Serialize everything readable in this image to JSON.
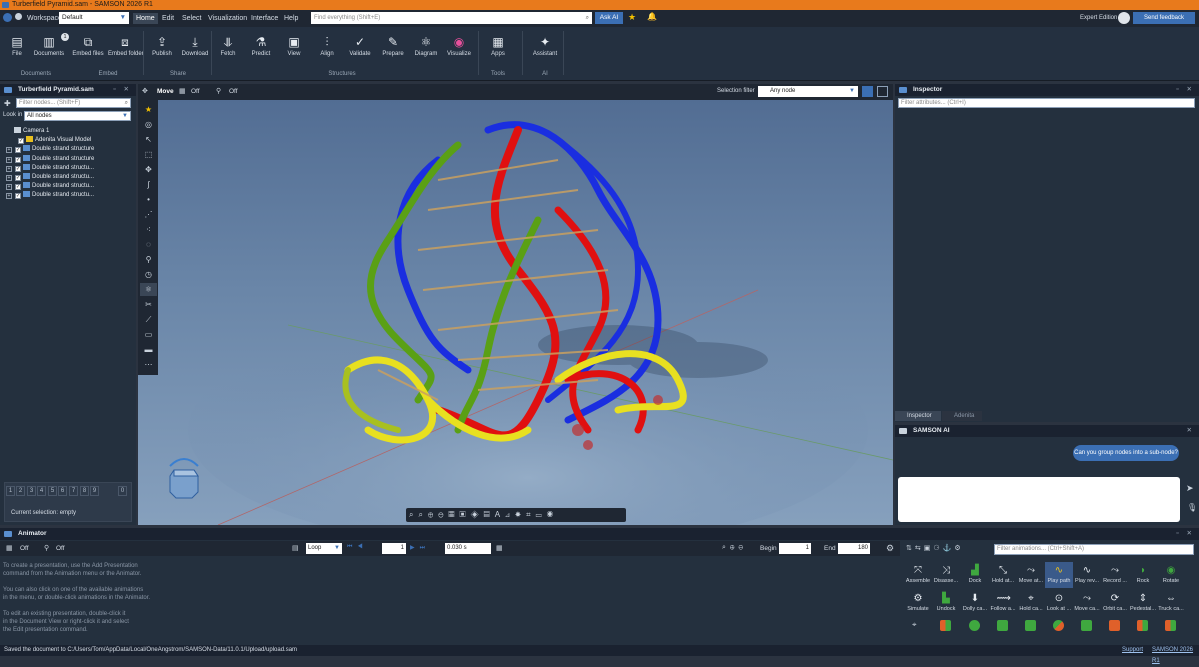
{
  "window": {
    "title": "Turberfield Pyramid.sam - SAMSON 2026 R1"
  },
  "menubar": {
    "workspace_label": "Workspace",
    "workspace_value": "Default",
    "menus": [
      "Home",
      "Edit",
      "Select",
      "Visualization",
      "Interface",
      "Help"
    ],
    "search_placeholder": "Find everything (Shift+E)",
    "ask_ai": "Ask AI",
    "edition": "Expert Edition",
    "feedback": "Send feedback"
  },
  "ribbon": {
    "buttons": [
      {
        "label": "File",
        "icon": "file-icon"
      },
      {
        "label": "Documents",
        "icon": "documents-icon",
        "badge": "1"
      },
      {
        "label": "Embed files",
        "icon": "embed-files-icon"
      },
      {
        "label": "Embed folder",
        "icon": "embed-folder-icon"
      },
      {
        "label": "Publish",
        "icon": "publish-icon"
      },
      {
        "label": "Download",
        "icon": "download-icon"
      },
      {
        "label": "Fetch",
        "icon": "fetch-icon"
      },
      {
        "label": "Predict",
        "icon": "predict-icon"
      },
      {
        "label": "View",
        "icon": "view-icon"
      },
      {
        "label": "Align",
        "icon": "align-icon"
      },
      {
        "label": "Validate",
        "icon": "validate-icon"
      },
      {
        "label": "Prepare",
        "icon": "prepare-icon"
      },
      {
        "label": "Diagram",
        "icon": "diagram-icon"
      },
      {
        "label": "Visualize",
        "icon": "visualize-icon"
      },
      {
        "label": "Apps",
        "icon": "apps-icon"
      },
      {
        "label": "Assistant",
        "icon": "assistant-icon"
      }
    ],
    "groups": [
      "Documents",
      "Embed",
      "Share",
      "Structures",
      "Tools",
      "AI"
    ]
  },
  "document_panel": {
    "title": "Turberfield Pyramid.sam",
    "filter_placeholder": "Filter nodes... (Shift+F)",
    "look_in_label": "Look in",
    "look_in_value": "All nodes",
    "nodes": [
      "Camera 1",
      "Adenita Visual Model",
      "Double strand structure",
      "Double strand structure",
      "Double strand structu...",
      "Double strand structu...",
      "Double strand structu...",
      "Double strand structu..."
    ],
    "number_keys": [
      "1",
      "2",
      "3",
      "4",
      "5",
      "6",
      "7",
      "8",
      "9",
      "0"
    ],
    "selection": "Current selection: empty"
  },
  "viewport_toolbar": {
    "move_label": "Move",
    "off1": "Off",
    "off2": "Off",
    "selection_filter_label": "Selection filter",
    "selection_filter_value": "Any node"
  },
  "inspector": {
    "title": "Inspector",
    "filter_placeholder": "Filter attributes... (Ctrl+I)",
    "tabs": [
      "Inspector",
      "Adenita"
    ]
  },
  "ai_panel": {
    "title": "SAMSON AI",
    "message": "Can you group nodes into a sub-node?"
  },
  "animator": {
    "title": "Animator",
    "off1": "Off",
    "off2": "Off",
    "loop": "Loop",
    "frame": "1",
    "time": "0.030 s",
    "begin_label": "Begin",
    "begin_value": "1",
    "end_label": "End",
    "end_value": "180",
    "filter_placeholder": "Filter animations... (Ctrl+Shift+A)",
    "help": [
      "To create a presentation, use the Add Presentation",
      "command from the Animation menu or the Animator.",
      "You can also click on one of the available animations",
      "in the menu, or double-click animations in the Animator.",
      "To edit an existing presentation, double-click it",
      "in the Document View or right-click it and select",
      "the Edit presentation command."
    ],
    "animations": [
      "Assemble",
      "Disasse...",
      "Dock",
      "Hold at...",
      "Move at...",
      "Play path",
      "Play rev...",
      "Record ...",
      "Rock",
      "Rotate",
      "Simulate",
      "Undock",
      "Dolly ca...",
      "Follow a...",
      "Hold ca...",
      "Look at ...",
      "Move ca...",
      "Orbit ca...",
      "Pedestal...",
      "Truck ca..."
    ]
  },
  "status": {
    "message": "Saved the document to C:/Users/Tom/AppData/Local/OneAngstrom/SAMSON-Data/11.0.1/Upload/upload.sam",
    "support": "Support",
    "version": "SAMSON 2026 R1"
  },
  "colors": {
    "accent": "#e87a1c",
    "strand_red": "#e01010",
    "strand_blue": "#1a2ee0",
    "strand_green": "#5aa015",
    "strand_yellow": "#e8e020"
  }
}
